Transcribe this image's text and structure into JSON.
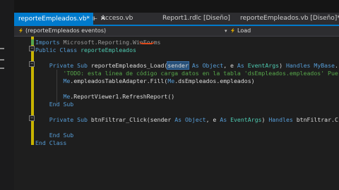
{
  "tabs": [
    {
      "label": "reporteEmpleados.vb*",
      "pin": "⊩",
      "close": "✕",
      "active": true
    },
    {
      "label": "Acceso.vb",
      "active": false
    },
    {
      "label": "Report1.rdlc [Diseño]",
      "active": false
    },
    {
      "label": "reporteEmpleados.vb [Diseño]*",
      "active": false
    }
  ],
  "navbar": {
    "class_combo": "(reporteEmpleados eventos)",
    "method_combo": "Load",
    "arrow": "▾"
  },
  "code_lines": [
    {
      "tokens": [
        {
          "t": "Imports ",
          "c": "kw"
        },
        {
          "t": "Microsoft.Reporting.WinForms",
          "c": "dim"
        }
      ]
    },
    {
      "tokens": [
        {
          "t": "Public ",
          "c": "kw"
        },
        {
          "t": "Class ",
          "c": "kw"
        },
        {
          "t": "reporteEmpleados",
          "c": "ty"
        }
      ]
    },
    {
      "tokens": []
    },
    {
      "tokens": [
        {
          "t": "    Private ",
          "c": "kw"
        },
        {
          "t": "Sub ",
          "c": "kw"
        },
        {
          "t": "reporteEmpleados_Load(",
          "c": "id"
        },
        {
          "t": "sender",
          "c": "id",
          "hl": true
        },
        {
          "t": " As ",
          "c": "kw"
        },
        {
          "t": "Object",
          "c": "kw"
        },
        {
          "t": ", e ",
          "c": "id"
        },
        {
          "t": "As ",
          "c": "kw"
        },
        {
          "t": "EventArgs",
          "c": "ty"
        },
        {
          "t": ") ",
          "c": "id"
        },
        {
          "t": "Handles ",
          "c": "kw"
        },
        {
          "t": "MyBase",
          "c": "kw"
        },
        {
          "t": ".",
          "c": "id"
        }
      ]
    },
    {
      "tokens": [
        {
          "t": "        'TODO: esta línea de código carga datos en la tabla 'dsEmpleados.empleados' Pue",
          "c": "cm"
        }
      ]
    },
    {
      "tokens": [
        {
          "t": "        ",
          "c": "id"
        },
        {
          "t": "Me",
          "c": "kw"
        },
        {
          "t": ".empleadosTableAdapter.Fill(",
          "c": "id"
        },
        {
          "t": "Me",
          "c": "kw"
        },
        {
          "t": ".dsEmpleados.empleados)",
          "c": "id"
        }
      ]
    },
    {
      "tokens": []
    },
    {
      "tokens": [
        {
          "t": "        ",
          "c": "id"
        },
        {
          "t": "Me",
          "c": "kw"
        },
        {
          "t": ".ReportViewer1.RefreshReport()",
          "c": "id"
        }
      ]
    },
    {
      "tokens": [
        {
          "t": "    End ",
          "c": "kw"
        },
        {
          "t": "Sub",
          "c": "kw"
        }
      ]
    },
    {
      "tokens": []
    },
    {
      "tokens": [
        {
          "t": "    Private ",
          "c": "kw"
        },
        {
          "t": "Sub ",
          "c": "kw"
        },
        {
          "t": "btnFiltrar_Click(sender ",
          "c": "id"
        },
        {
          "t": "As ",
          "c": "kw"
        },
        {
          "t": "Object",
          "c": "kw"
        },
        {
          "t": ", e ",
          "c": "id"
        },
        {
          "t": "As ",
          "c": "kw"
        },
        {
          "t": "EventArgs",
          "c": "ty"
        },
        {
          "t": ") ",
          "c": "id"
        },
        {
          "t": "Handles ",
          "c": "kw"
        },
        {
          "t": "btnFiltrar.C",
          "c": "id"
        }
      ]
    },
    {
      "tokens": []
    },
    {
      "tokens": [
        {
          "t": "    End ",
          "c": "kw"
        },
        {
          "t": "Sub",
          "c": "kw"
        }
      ]
    },
    {
      "tokens": [
        {
          "t": "End ",
          "c": "kw"
        },
        {
          "t": "Class",
          "c": "kw"
        }
      ]
    }
  ],
  "outline_glyphs": {
    "collapse": "−"
  }
}
